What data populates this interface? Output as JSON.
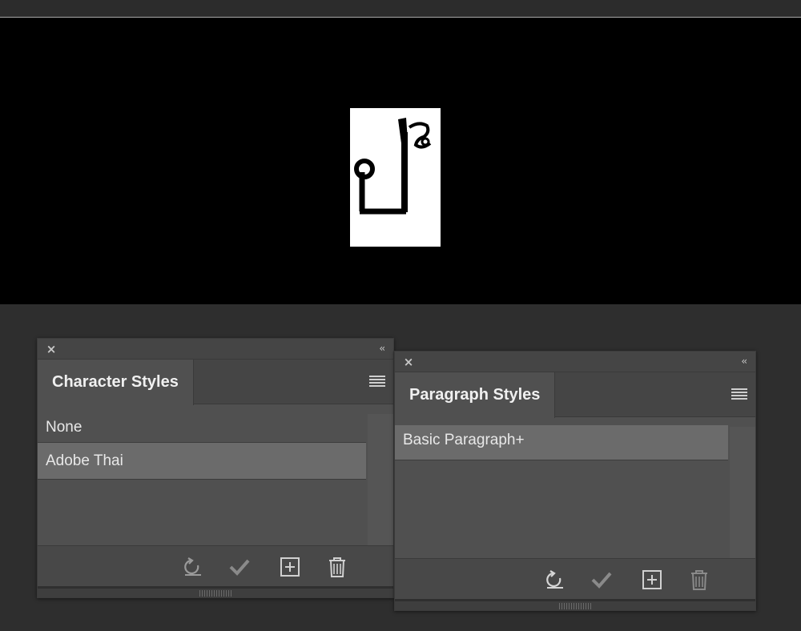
{
  "character_styles_panel": {
    "tab_label": "Character Styles",
    "close_icon": "×",
    "collapse_icon": "‹‹",
    "items": [
      {
        "label": "None",
        "selected": false
      },
      {
        "label": "Adobe Thai",
        "selected": true
      }
    ],
    "footer_icons": [
      "clear-overrides-icon",
      "apply-checkmark-icon",
      "new-style-icon",
      "delete-icon"
    ]
  },
  "paragraph_styles_panel": {
    "tab_label": "Paragraph Styles",
    "close_icon": "×",
    "collapse_icon": "‹‹",
    "items": [
      {
        "label": "Basic Paragraph+",
        "selected": true
      }
    ],
    "footer_icons": [
      "clear-overrides-icon",
      "apply-checkmark-icon",
      "new-style-icon",
      "delete-icon"
    ]
  },
  "colors": {
    "panel_bg": "#505050",
    "selected_row": "#6b6b6b",
    "canvas_bg": "#000000"
  }
}
